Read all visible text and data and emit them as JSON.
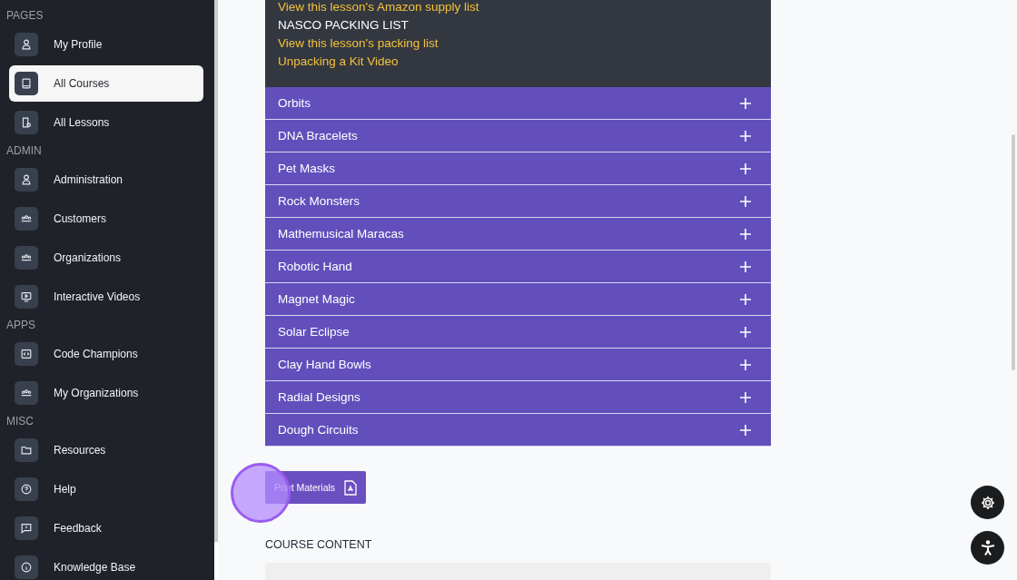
{
  "sidebar": {
    "sections": [
      {
        "title": "PAGES",
        "items": [
          {
            "label": "My Profile",
            "kind": "person",
            "selected": false
          },
          {
            "label": "All Courses",
            "kind": "book",
            "selected": true
          },
          {
            "label": "All Lessons",
            "kind": "lesson",
            "selected": false
          }
        ]
      },
      {
        "title": "ADMIN",
        "items": [
          {
            "label": "Administration",
            "kind": "person",
            "selected": false
          },
          {
            "label": "Customers",
            "kind": "group",
            "selected": false
          },
          {
            "label": "Organizations",
            "kind": "group",
            "selected": false
          },
          {
            "label": "Interactive Videos",
            "kind": "video",
            "selected": false
          }
        ]
      },
      {
        "title": "APPS",
        "items": [
          {
            "label": "Code Champions",
            "kind": "code",
            "selected": false
          },
          {
            "label": "My Organizations",
            "kind": "group",
            "selected": false
          }
        ]
      },
      {
        "title": "MISC",
        "items": [
          {
            "label": "Resources",
            "kind": "folder",
            "selected": false
          },
          {
            "label": "Help",
            "kind": "help",
            "selected": false
          },
          {
            "label": "Feedback",
            "kind": "feedback",
            "selected": false
          },
          {
            "label": "Knowledge Base",
            "kind": "info",
            "selected": false
          }
        ]
      }
    ]
  },
  "materials": [
    {
      "text": "View this lesson's Amazon supply list",
      "kind": "link"
    },
    {
      "text": "NASCO PACKING LIST",
      "kind": "heading"
    },
    {
      "text": "View this lesson's packing list",
      "kind": "link"
    },
    {
      "text": "Unpacking a Kit Video",
      "kind": "link"
    }
  ],
  "lessons": [
    {
      "title": "Orbits",
      "expanded": false
    },
    {
      "title": "DNA Bracelets",
      "expanded": false
    },
    {
      "title": "Pet Masks",
      "expanded": false
    },
    {
      "title": "Rock Monsters",
      "expanded": false
    },
    {
      "title": "Mathemusical Maracas",
      "expanded": false
    },
    {
      "title": "Robotic Hand",
      "expanded": false
    },
    {
      "title": "Magnet Magic",
      "expanded": false
    },
    {
      "title": "Solar Eclipse",
      "expanded": false
    },
    {
      "title": "Clay Hand Bowls",
      "expanded": false
    },
    {
      "title": "Radial Designs",
      "expanded": false
    },
    {
      "title": "Dough Circuits",
      "expanded": false
    }
  ],
  "print_button": {
    "label": "Print Materials"
  },
  "section_heading": "COURSE CONTENT"
}
